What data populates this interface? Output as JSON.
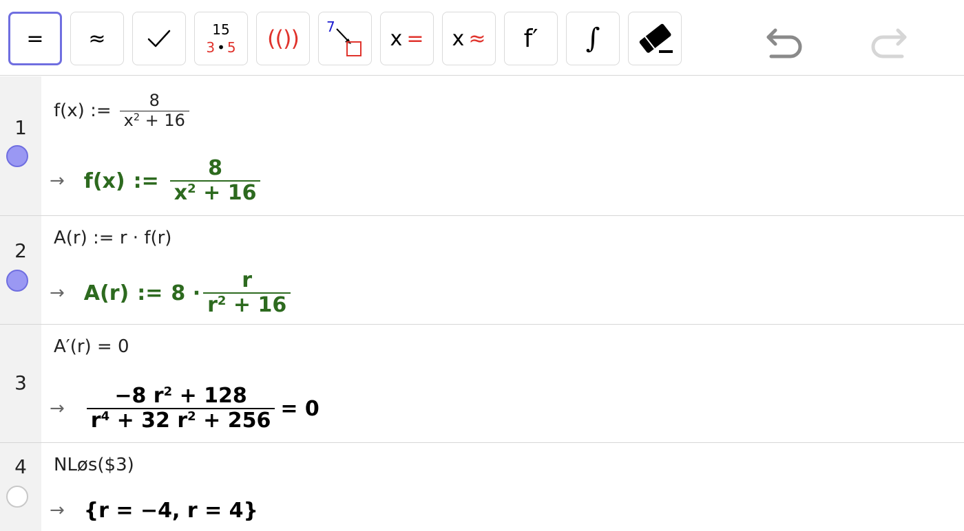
{
  "toolbar": {
    "buttons": [
      {
        "name": "evaluate",
        "label": "="
      },
      {
        "name": "numeric",
        "label": "≈"
      },
      {
        "name": "keep-input",
        "label": "✓"
      },
      {
        "name": "factor",
        "top": "15",
        "bottom_left": "3",
        "bottom_dot": "•",
        "bottom_right": "5"
      },
      {
        "name": "expand",
        "left": "((",
        "right": "))"
      },
      {
        "name": "substitute",
        "label": "7"
      },
      {
        "name": "solve",
        "x": "x",
        "sym": "="
      },
      {
        "name": "solve-numerically",
        "x": "x",
        "sym": "≈"
      },
      {
        "name": "derivative",
        "label": "f′"
      },
      {
        "name": "integral",
        "label": "∫"
      },
      {
        "name": "delete",
        "label": ""
      }
    ],
    "undo_label": "undo",
    "redo_label": "redo"
  },
  "rows": [
    {
      "num": "1",
      "input": {
        "lhs": "f(x) :=",
        "num": "8",
        "den_base": "x",
        "den_exp": "2",
        "den_rest": "+ 16"
      },
      "output": {
        "arrow": "→",
        "lhs": "f(x)",
        "assign": ":=",
        "num": "8",
        "den_base": "x",
        "den_exp": "2",
        "den_rest": "+ 16"
      },
      "marble": "filled"
    },
    {
      "num": "2",
      "input": {
        "text": "A(r) :=  r · f(r)"
      },
      "output": {
        "arrow": "→",
        "lhs": "A(r)",
        "assign": ":=",
        "coef": "8 ·",
        "num": "r",
        "den_base": "r",
        "den_exp": "2",
        "den_rest": "+ 16"
      },
      "marble": "filled"
    },
    {
      "num": "3",
      "input": {
        "text": "A′(r)  =  0"
      },
      "output": {
        "arrow": "→",
        "num_a": "−8 r",
        "num_exp": "2",
        "num_rest": "+ 128",
        "den_a": "r",
        "den_a_exp": "4",
        "den_b": "+ 32 r",
        "den_b_exp": "2",
        "den_c": "+ 256",
        "rhs": "= 0"
      },
      "marble": "none"
    },
    {
      "num": "4",
      "input": {
        "text": "NLøs($3)"
      },
      "output": {
        "arrow": "→",
        "text": "{r = −4, r = 4}"
      },
      "marble": "empty"
    }
  ]
}
